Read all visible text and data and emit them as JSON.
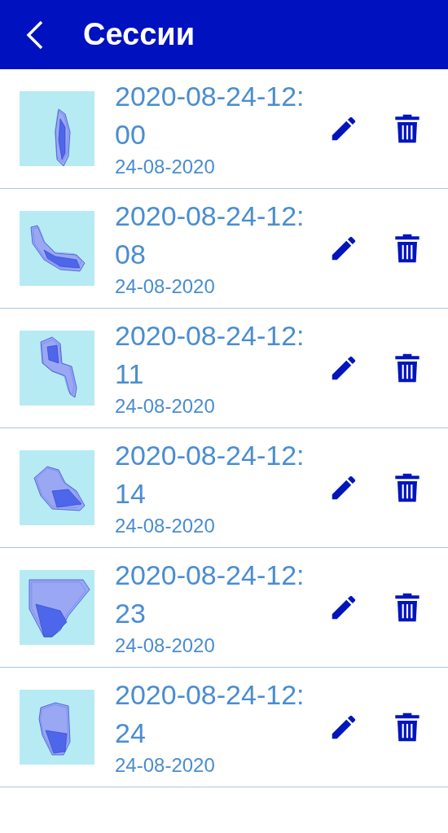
{
  "header": {
    "title": "Сессии"
  },
  "sessions": [
    {
      "title": "2020-08-24-12:00",
      "date": "24-08-2020"
    },
    {
      "title": "2020-08-24-12:08",
      "date": "24-08-2020"
    },
    {
      "title": "2020-08-24-12:11",
      "date": "24-08-2020"
    },
    {
      "title": "2020-08-24-12:14",
      "date": "24-08-2020"
    },
    {
      "title": "2020-08-24-12:23",
      "date": "24-08-2020"
    },
    {
      "title": "2020-08-24-12:24",
      "date": "24-08-2020"
    }
  ]
}
